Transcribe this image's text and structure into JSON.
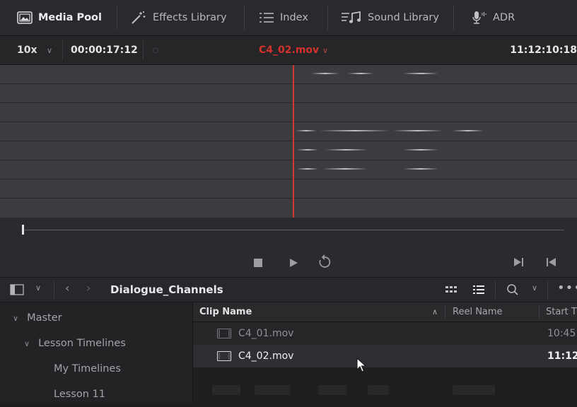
{
  "tabs": [
    {
      "label": "Media Pool",
      "icon": "media-pool-icon",
      "active": true
    },
    {
      "label": "Effects Library",
      "icon": "effects-wand-icon",
      "active": false
    },
    {
      "label": "Index",
      "icon": "index-list-icon",
      "active": false
    },
    {
      "label": "Sound Library",
      "icon": "sound-library-icon",
      "active": false
    },
    {
      "label": "ADR",
      "icon": "microphone-icon",
      "active": false
    }
  ],
  "viewer": {
    "zoom": "10x",
    "timecode_left": "00:00:17:12",
    "clip_title": "C4_02.mov",
    "timecode_right": "11:12:10:18"
  },
  "media_pool": {
    "bin_name": "Dialogue_Channels",
    "bins": [
      {
        "label": "Master",
        "expanded": true
      },
      {
        "label": "Lesson Timelines",
        "expanded": true
      },
      {
        "label": "My Timelines"
      },
      {
        "label": "Lesson 11"
      }
    ],
    "columns": {
      "clip_name": "Clip Name",
      "reel_name": "Reel Name",
      "start": "Start T"
    },
    "clips": [
      {
        "name": "C4_01.mov",
        "start": "10:45"
      },
      {
        "name": "C4_02.mov",
        "start": "11:12",
        "selected": true
      }
    ]
  },
  "colors": {
    "playhead": "#d3362d",
    "clip_title": "#d3312b",
    "waveform_bg": "#3b3c40"
  }
}
